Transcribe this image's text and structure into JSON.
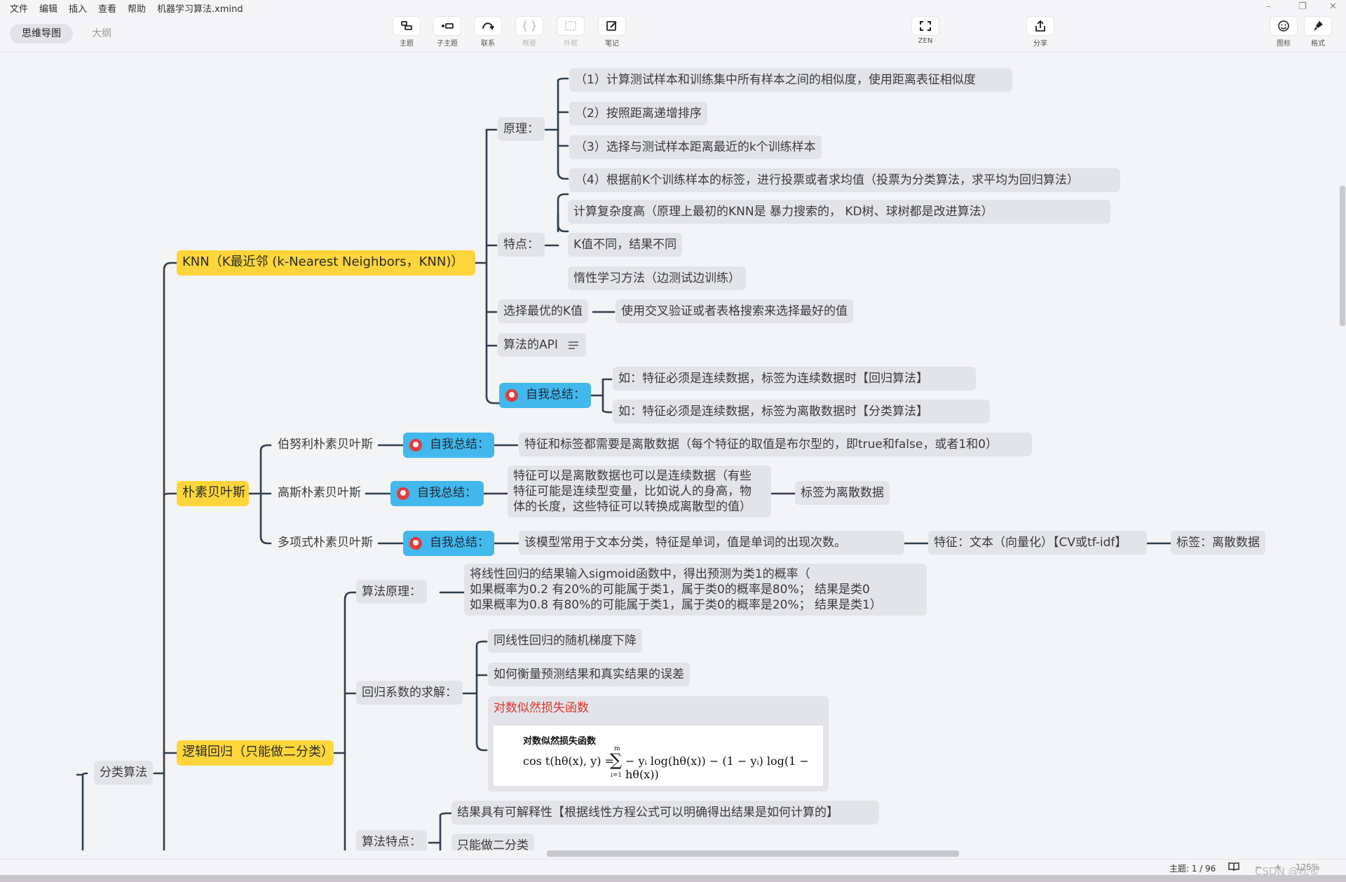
{
  "menu": {
    "items": [
      "文件",
      "编辑",
      "插入",
      "查看",
      "帮助"
    ],
    "filename": "机器学习算法.xmind"
  },
  "window_controls": [
    "–",
    "❐",
    "✕"
  ],
  "view_tabs": {
    "mindmap": "思维导图",
    "outline": "大纲"
  },
  "toolbar": {
    "topic": "主题",
    "subtopic": "子主题",
    "relation": "联系",
    "summary": "概要",
    "boundary": "外框",
    "note": "笔记",
    "zen": "ZEN",
    "share": "分享",
    "icon": "图标",
    "format": "格式"
  },
  "mindmap": {
    "root": "分类算法",
    "knn": {
      "title": "KNN（K最近邻 (k-Nearest Neighbors，KNN)）",
      "principle": "原理：",
      "principle_items": [
        "（1）计算测试样本和训练集中所有样本之间的相似度，使用距离表征相似度",
        "（2）按照距离递增排序",
        "（3）选择与测试样本距离最近的k个训练样本",
        "（4）根据前K个训练样本的标签，进行投票或者求均值（投票为分类算法，求平均为回归算法）"
      ],
      "features": "特点：",
      "feature_items": [
        "计算复杂度高（原理上最初的KNN是 暴力搜索的， KD树、球树都是改进算法）",
        "K值不同，结果不同",
        "惰性学习方法（边测试边训练）"
      ],
      "best_k": "选择最优的K值",
      "best_k_detail": "使用交叉验证或者表格搜索来选择最好的值",
      "api": "算法的API",
      "summary": "自我总结：",
      "summary_items": [
        "如：特征必须是连续数据，标签为连续数据时【回归算法】",
        "如：特征必须是连续数据，标签为离散数据时【分类算法】"
      ]
    },
    "nb": {
      "title": "朴素贝叶斯",
      "bernoulli": "伯努利朴素贝叶斯",
      "bernoulli_summary": "自我总结：",
      "bernoulli_detail": "特征和标签都需要是离散数据（每个特征的取值是布尔型的，即true和false，或者1和0）",
      "gaussian": "高斯朴素贝叶斯",
      "gaussian_summary": "自我总结：",
      "gaussian_detail": [
        "特征可以是离散数据也可以是连续数据（有些",
        "特征可能是连续型变量，比如说人的身高，物",
        "体的长度，这些特征可以转换成离散型的值）"
      ],
      "gaussian_label": "标签为离散数据",
      "multinomial": "多项式朴素贝叶斯",
      "multinomial_summary": "自我总结：",
      "multinomial_detail": "该模型常用于文本分类，特征是单词，值是单词的出现次数。",
      "multinomial_feature": "特征：文本（向量化）【CV或tf-idf】",
      "multinomial_label": "标签：离散数据"
    },
    "lr": {
      "title": "逻辑回归（只能做二分类）",
      "principle": "算法原理：",
      "principle_detail": [
        "将线性回归的结果输入sigmoid函数中，得出预测为类1的概率（",
        "如果概率为0.2 有20%的可能属于类1，属于类0的概率是80%；  结果是类0",
        "如果概率为0.8 有80%的可能属于类1，属于类0的概率是20%；  结果是类1）"
      ],
      "coef": "回归系数的求解：",
      "coef_items": [
        "同线性回归的随机梯度下降",
        "如何衡量预测结果和真实结果的误差"
      ],
      "loss_title": "对数似然损失函数",
      "formula_caption": "对数似然损失函数",
      "formula_lhs": "cos t(hθ(x), y) =",
      "formula_sum_top": "m",
      "formula_sum_bottom": "i=1",
      "formula_rhs": "− yᵢ log(hθ(x)) − (1 − yᵢ) log(1 − hθ(x))",
      "traits": "算法特点：",
      "trait_items": [
        "结果具有可解释性【根据线性方程公式可以明确得出结果是如何计算的】",
        "只能做二分类"
      ]
    }
  },
  "status": {
    "topic_count": "主题: 1 / 96",
    "zoom": "125%",
    "watermark": "CSDN @松炙"
  },
  "colors": {
    "central_topic": "#fed53a",
    "summary_marker": "#42b8ec",
    "node_gray": "#e2e4e9",
    "line": "#2f3e4c",
    "red_title": "#e0342c"
  }
}
